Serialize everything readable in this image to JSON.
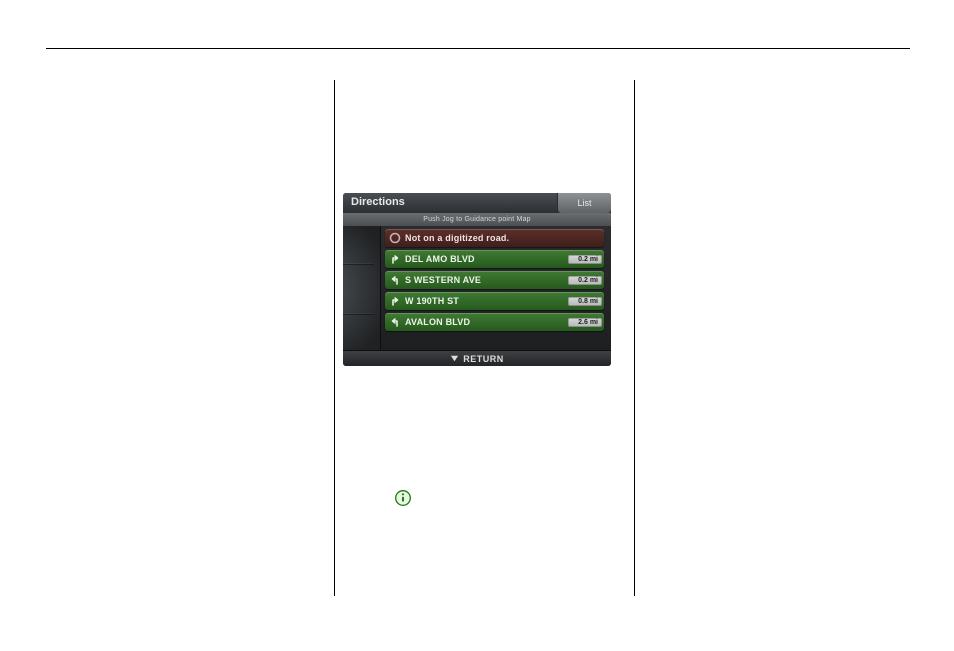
{
  "device": {
    "title": "Directions",
    "tab": "List",
    "subbar": "Push Jog to Guidance point Map",
    "rows": [
      {
        "type": "error",
        "icon": "stop",
        "street": "Not on a digitized road.",
        "dist": ""
      },
      {
        "type": "ok",
        "icon": "right",
        "street": "DEL AMO BLVD",
        "dist": "0.2 mi"
      },
      {
        "type": "ok",
        "icon": "left",
        "street": "S WESTERN AVE",
        "dist": "0.2 mi"
      },
      {
        "type": "ok",
        "icon": "right",
        "street": "W 190TH ST",
        "dist": "0.8 mi"
      },
      {
        "type": "ok",
        "icon": "left",
        "street": "AVALON BLVD",
        "dist": "2.6 mi"
      }
    ],
    "return": "RETURN"
  }
}
